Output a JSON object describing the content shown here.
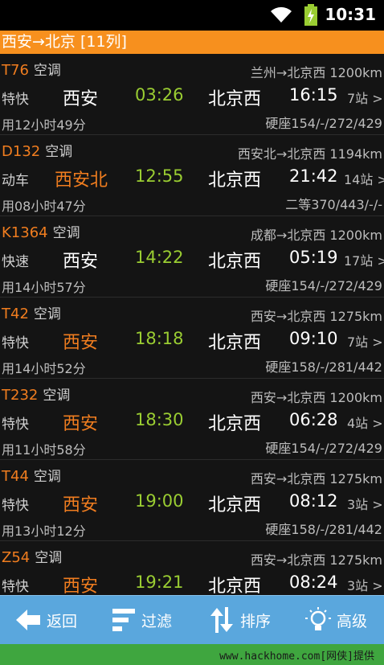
{
  "status": {
    "time": "10:31",
    "icons": [
      "wifi-icon",
      "battery-charging-icon"
    ]
  },
  "title": "西安→北京 [11列]",
  "trains": [
    {
      "code": "T76",
      "ac": "空调",
      "route": "兰州→北京西 1200km",
      "type": "特快",
      "from": "西安",
      "dep": "03:26",
      "to": "北京西",
      "arr": "16:15",
      "stops": "7站 >",
      "duration": "用12小时49分",
      "seats": "硬座154/-/272/429"
    },
    {
      "code": "D132",
      "ac": "空调",
      "route": "西安北→北京西 1194km",
      "type": "动车",
      "from": "西安北",
      "dep": "12:55",
      "to": "北京西",
      "arr": "21:42",
      "stops": "14站 >",
      "duration": "用08小时47分",
      "seats": "二等370/443/-/-"
    },
    {
      "code": "K1364",
      "ac": "空调",
      "route": "成都→北京西 1200km",
      "type": "快速",
      "from": "西安",
      "dep": "14:22",
      "to": "北京西",
      "arr": "05:19",
      "stops": "17站 >",
      "duration": "用14小时57分",
      "seats": "硬座154/-/272/429"
    },
    {
      "code": "T42",
      "ac": "空调",
      "route": "西安→北京西 1275km",
      "type": "特快",
      "from": "西安",
      "dep": "18:18",
      "to": "北京西",
      "arr": "09:10",
      "stops": "7站 >",
      "duration": "用14小时52分",
      "seats": "硬座158/-/281/442"
    },
    {
      "code": "T232",
      "ac": "空调",
      "route": "西安→北京西 1200km",
      "type": "特快",
      "from": "西安",
      "dep": "18:30",
      "to": "北京西",
      "arr": "06:28",
      "stops": "4站 >",
      "duration": "用11小时58分",
      "seats": "硬座154/-/272/429"
    },
    {
      "code": "T44",
      "ac": "空调",
      "route": "西安→北京西 1275km",
      "type": "特快",
      "from": "西安",
      "dep": "19:00",
      "to": "北京西",
      "arr": "08:12",
      "stops": "3站 >",
      "duration": "用13小时12分",
      "seats": "硬座158/-/281/442"
    },
    {
      "code": "Z54",
      "ac": "空调",
      "route": "西安→北京西 1275km",
      "type": "特快",
      "from": "西安",
      "dep": "19:21",
      "to": "北京西",
      "arr": "08:24",
      "stops": "3站 >",
      "duration": "",
      "seats": ""
    }
  ],
  "toolbar": {
    "back": "返回",
    "filter": "过滤",
    "sort": "排序",
    "advanced": "高级"
  },
  "footer": "www.hackhome.com[网侠]提供",
  "colors": {
    "titlebar": "#f7901e",
    "toolbar": "#5aa7dd",
    "footer": "#3fa63f",
    "code": "#f07d1f",
    "depart_time": "#9acd32"
  }
}
